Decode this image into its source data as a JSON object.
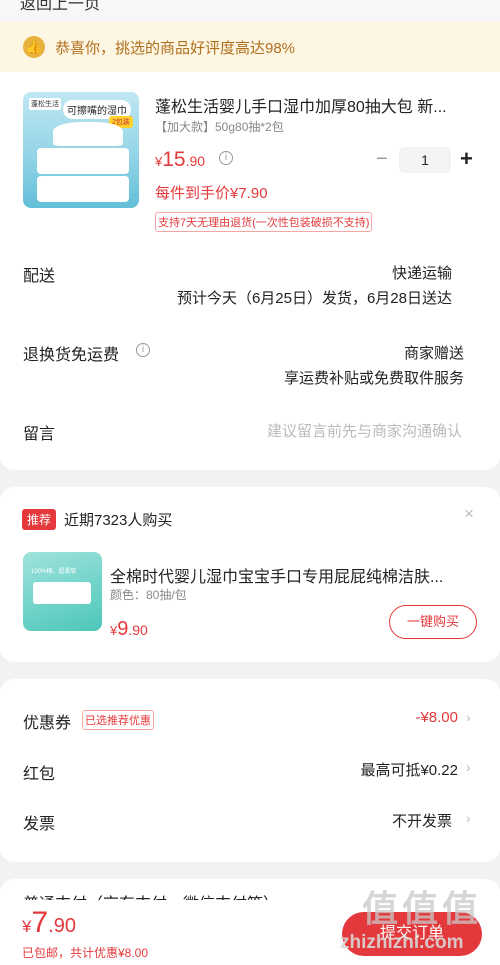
{
  "top_cut": {
    "text": "返回上一页"
  },
  "banner": {
    "text": "恭喜你，挑选的商品好评度高达98%"
  },
  "product": {
    "title": "蓬松生活婴儿手口湿巾加厚80抽大包 新...",
    "spec": "【加大款】50g80抽*2包",
    "price_currency": "¥",
    "price_int": "15",
    "price_dec": ".90",
    "quantity": "1",
    "minus_label": "−",
    "plus_label": "+",
    "unit_price": "每件到手价¥7.90",
    "return_badge": "支持7天无理由退货(一次性包装破损不支持)",
    "image_texts": {
      "brand": "蓬松生活",
      "tag": "可擦嘴的湿巾",
      "tag2": "2包装"
    }
  },
  "delivery": {
    "label": "配送",
    "method": "快递运输",
    "estimate": "预计今天（6月25日）发货，6月28日送达"
  },
  "return_shipping": {
    "label": "退换货免运费",
    "value": "商家赠送",
    "desc": "享运费补贴或免费取件服务"
  },
  "message": {
    "label": "留言",
    "placeholder": "建议留言前先与商家沟通确认"
  },
  "recommend": {
    "badge": "推荐",
    "text": "近期7323人购买",
    "close": "×",
    "title": "全棉时代婴儿湿巾宝宝手口专用屁屁纯棉洁肤...",
    "spec": "颜色：80抽/包",
    "price_currency": "¥",
    "price_int": "9",
    "price_dec": ".90",
    "button": "一键购买",
    "image_text": "100%棉，超柔软"
  },
  "coupons": {
    "coupon_label": "优惠券",
    "coupon_tag": "已选推荐优惠",
    "coupon_value": "-¥8.00",
    "redpacket_label": "红包",
    "redpacket_value": "最高可抵¥0.22",
    "invoice_label": "发票",
    "invoice_value": "不开发票",
    "chevron": "›"
  },
  "payment": {
    "label": "普通支付（京东支付、微信支付等）"
  },
  "bottom": {
    "total_currency": "¥",
    "total_int": "7",
    "total_dec": ".90",
    "shipping_note": "已包邮，共计优惠¥8.00",
    "submit": "提交订单"
  },
  "watermark": {
    "logo": "值值值",
    "url": "zhizhizhi.com"
  },
  "colors": {
    "accent": "#e4393c",
    "banner_bg": "#fcf6e3",
    "banner_text": "#b06f1d",
    "page_bg": "#f2f2f2"
  }
}
